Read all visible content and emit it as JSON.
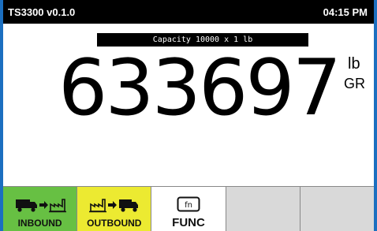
{
  "header": {
    "app_title": "TS3300 v0.1.0",
    "time": "04:15 PM"
  },
  "scale": {
    "capacity_label": "Capacity 10000 x 1 lb",
    "weight": "633697",
    "unit": "lb",
    "mode": "GR"
  },
  "softkeys": [
    {
      "label": "INBOUND",
      "icon": "truck-to-factory-icon",
      "color": "#67c043"
    },
    {
      "label": "OUTBOUND",
      "icon": "factory-to-truck-icon",
      "color": "#ecea31"
    },
    {
      "label": "FUNC",
      "icon": "fn-key-icon",
      "color": "#ffffff"
    },
    {
      "label": "",
      "color": "#d9d9d9"
    },
    {
      "label": "",
      "color": "#d9d9d9"
    }
  ]
}
